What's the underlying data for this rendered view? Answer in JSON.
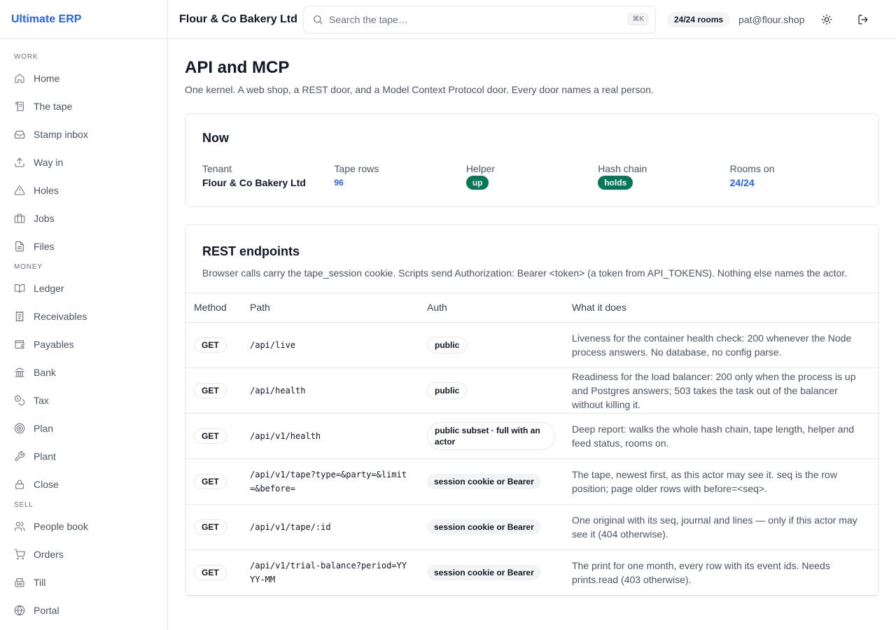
{
  "app": {
    "name": "Ultimate ERP"
  },
  "sidebar": {
    "sections": [
      {
        "label": "Work",
        "items": [
          {
            "label": "Home",
            "icon": "home-icon"
          },
          {
            "label": "The tape",
            "icon": "scroll-icon"
          },
          {
            "label": "Stamp inbox",
            "icon": "inbox-icon"
          },
          {
            "label": "Way in",
            "icon": "upload-icon"
          },
          {
            "label": "Holes",
            "icon": "warning-icon"
          },
          {
            "label": "Jobs",
            "icon": "briefcase-icon"
          },
          {
            "label": "Files",
            "icon": "file-icon"
          }
        ]
      },
      {
        "label": "Money",
        "items": [
          {
            "label": "Ledger",
            "icon": "book-icon"
          },
          {
            "label": "Receivables",
            "icon": "receipt-icon"
          },
          {
            "label": "Payables",
            "icon": "wallet-icon"
          },
          {
            "label": "Bank",
            "icon": "bank-icon"
          },
          {
            "label": "Tax",
            "icon": "coins-icon"
          },
          {
            "label": "Plan",
            "icon": "target-icon"
          },
          {
            "label": "Plant",
            "icon": "wrench-icon"
          },
          {
            "label": "Close",
            "icon": "lock-icon"
          }
        ]
      },
      {
        "label": "Sell",
        "items": [
          {
            "label": "People book",
            "icon": "users-icon"
          },
          {
            "label": "Orders",
            "icon": "cart-icon"
          },
          {
            "label": "Till",
            "icon": "register-icon"
          },
          {
            "label": "Portal",
            "icon": "globe-icon"
          }
        ]
      }
    ]
  },
  "topbar": {
    "org_name": "Flour & Co Bakery Ltd",
    "search_placeholder": "Search the tape…",
    "search_shortcut": "⌘K",
    "rooms_badge": "24/24 rooms",
    "user_email": "pat@flour.shop"
  },
  "page": {
    "title": "API and MCP",
    "subtitle": "One kernel. A web shop, a REST door, and a Model Context Protocol door. Every door names a real person."
  },
  "now": {
    "title": "Now",
    "stats": {
      "tenant": {
        "label": "Tenant",
        "value": "Flour & Co Bakery Ltd"
      },
      "tape_rows": {
        "label": "Tape rows",
        "value": "96"
      },
      "helper": {
        "label": "Helper",
        "value": "up"
      },
      "hash_chain": {
        "label": "Hash chain",
        "value": "holds"
      },
      "rooms_on": {
        "label": "Rooms on",
        "value": "24/24"
      }
    }
  },
  "rest": {
    "title": "REST endpoints",
    "description": "Browser calls carry the tape_session cookie. Scripts send Authorization: Bearer <token> (a token from API_TOKENS). Nothing else names the actor.",
    "columns": [
      "Method",
      "Path",
      "Auth",
      "What it does"
    ],
    "rows": [
      {
        "method": "GET",
        "path": "/api/live",
        "auth": "public",
        "auth_style": "outline",
        "what": "Liveness for the container health check: 200 whenever the Node process answers. No database, no config parse."
      },
      {
        "method": "GET",
        "path": "/api/health",
        "auth": "public",
        "auth_style": "outline",
        "what": "Readiness for the load balancer: 200 only when the process is up and Postgres answers; 503 takes the task out of the balancer without killing it."
      },
      {
        "method": "GET",
        "path": "/api/v1/health",
        "auth": "public subset · full with an actor",
        "auth_style": "outline",
        "what": "Deep report: walks the whole hash chain, tape length, helper and feed status, rooms on."
      },
      {
        "method": "GET",
        "path": "/api/v1/tape?type=&party=&limit=&before=",
        "auth": "session cookie or Bearer",
        "auth_style": "filled",
        "what": "The tape, newest first, as this actor may see it. seq is the row position; page older rows with before=<seq>."
      },
      {
        "method": "GET",
        "path": "/api/v1/tape/:id",
        "auth": "session cookie or Bearer",
        "auth_style": "filled",
        "what": "One original with its seq, journal and lines — only if this actor may see it (404 otherwise)."
      },
      {
        "method": "GET",
        "path": "/api/v1/trial-balance?period=YYYY-MM",
        "auth": "session cookie or Bearer",
        "auth_style": "filled",
        "what": "The print for one month, every row with its event ids. Needs prints.read (403 otherwise)."
      }
    ]
  }
}
